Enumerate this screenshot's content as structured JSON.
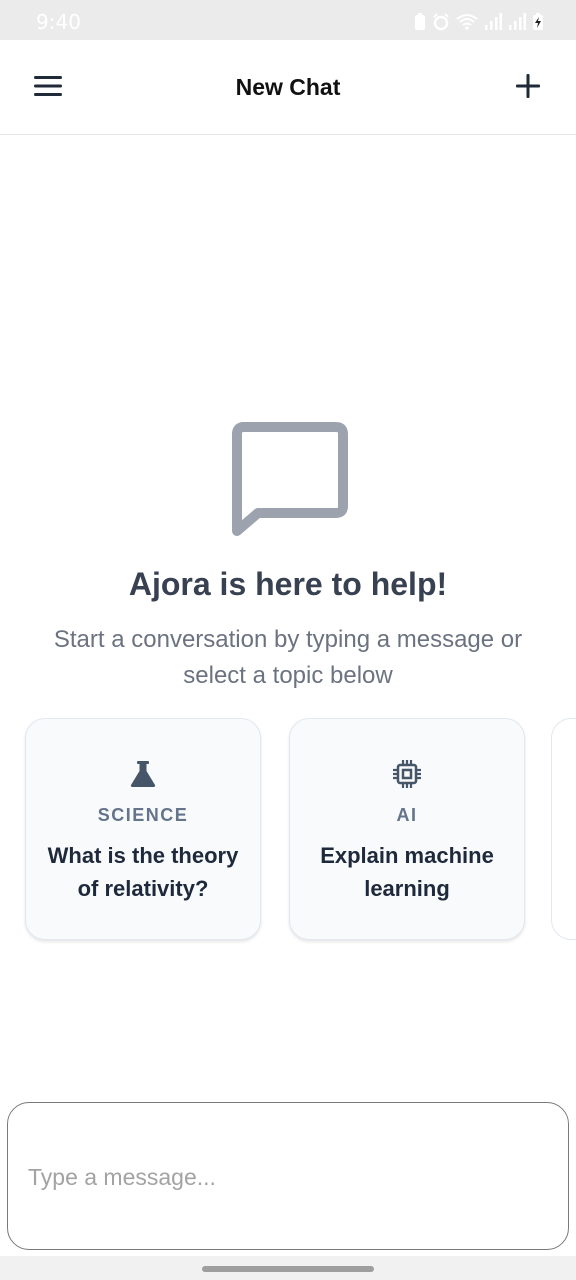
{
  "status_bar": {
    "time": "9:40",
    "icons": [
      "battery-saver-icon",
      "alarm-icon",
      "wifi-icon",
      "signal-icon",
      "signal-icon",
      "battery-charging-icon"
    ]
  },
  "header": {
    "title": "New Chat",
    "menu_icon": "hamburger-menu-icon",
    "new_chat_icon": "plus-icon"
  },
  "empty_state": {
    "icon": "chat-bubble-icon",
    "title": "Ajora is here to help!",
    "subtitle": "Start a conversation by typing a message or select a topic below"
  },
  "topics": [
    {
      "icon": "flask-icon",
      "category": "SCIENCE",
      "question": "What is the theory of relativity?"
    },
    {
      "icon": "chip-icon",
      "category": "AI",
      "question": "Explain machine learning"
    }
  ],
  "composer": {
    "placeholder": "Type a message..."
  },
  "colors": {
    "icon_gray": "#9ca3af",
    "heading": "#374151",
    "muted_text": "#6b7280",
    "card_bg": "#f8fafc",
    "card_border": "#e2e8f0",
    "topic_icon": "#475569"
  }
}
